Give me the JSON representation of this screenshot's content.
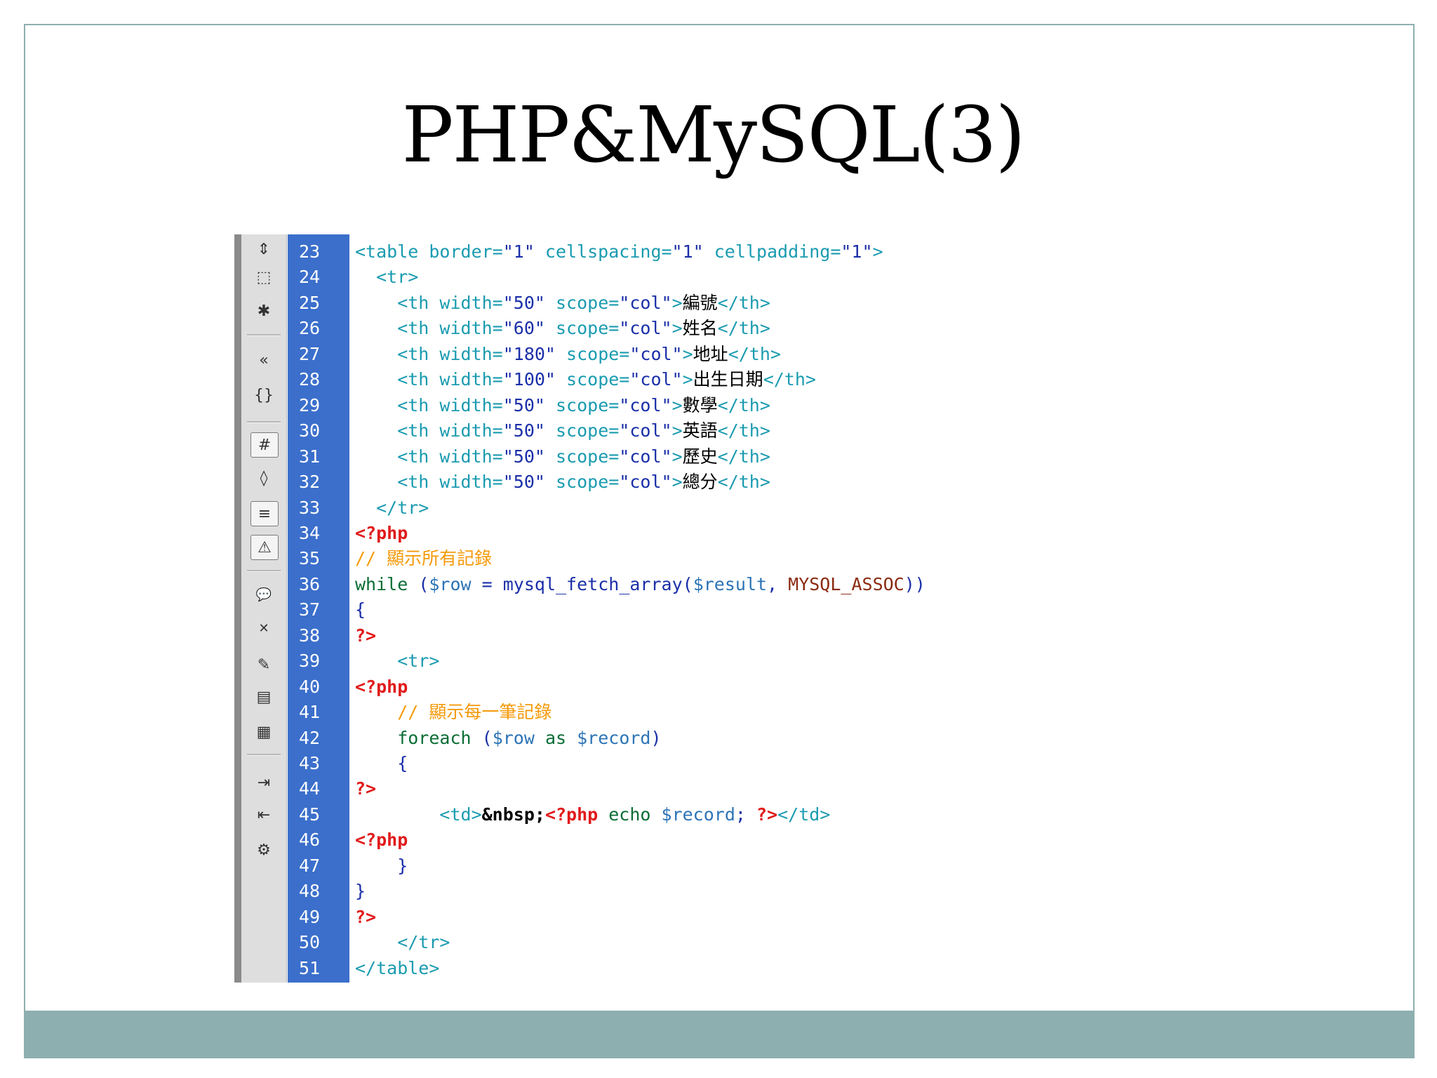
{
  "slide": {
    "title": "PHP&MySQL(3)"
  },
  "colors": {
    "frame": "#8eafb0",
    "gutter": "#3b6fcb",
    "tag": "#1a9bb0",
    "attr_value": "#1a2fa8",
    "php_delim": "#e11a1a",
    "comment": "#f49a0a",
    "keyword": "#0a6d34",
    "variable": "#2d74b6"
  },
  "toolbar": {
    "icons": [
      "collapse-full-tag-icon",
      "collapse-selection-icon",
      "expand-all-icon",
      "select-parent-tag-icon",
      "balance-braces-icon",
      "line-numbers-icon",
      "highlight-invalid-code-icon",
      "word-wrap-icon",
      "syntax-error-alerts-icon",
      "apply-comment-icon",
      "remove-comment-icon",
      "wrap-tag-icon",
      "recent-snippets-icon",
      "move-css-icon",
      "indent-code-icon",
      "outdent-code-icon",
      "format-source-code-icon"
    ]
  },
  "code": {
    "lines": [
      {
        "n": "23",
        "tokens": [
          {
            "c": "tag",
            "t": "<table border="
          },
          {
            "c": "val",
            "t": "\"1\""
          },
          {
            "c": "tag",
            "t": " cellspacing="
          },
          {
            "c": "val",
            "t": "\"1\""
          },
          {
            "c": "tag",
            "t": " cellpadding="
          },
          {
            "c": "val",
            "t": "\"1\""
          },
          {
            "c": "tag",
            "t": ">"
          }
        ]
      },
      {
        "n": "24",
        "tokens": [
          {
            "c": "tag",
            "t": "  <tr>"
          }
        ]
      },
      {
        "n": "25",
        "tokens": [
          {
            "c": "tag",
            "t": "    <th width="
          },
          {
            "c": "val",
            "t": "\"50\""
          },
          {
            "c": "tag",
            "t": " scope="
          },
          {
            "c": "val",
            "t": "\"col\""
          },
          {
            "c": "tag",
            "t": ">"
          },
          {
            "c": "txt",
            "t": "編號"
          },
          {
            "c": "tag",
            "t": "</th>"
          }
        ]
      },
      {
        "n": "26",
        "tokens": [
          {
            "c": "tag",
            "t": "    <th width="
          },
          {
            "c": "val",
            "t": "\"60\""
          },
          {
            "c": "tag",
            "t": " scope="
          },
          {
            "c": "val",
            "t": "\"col\""
          },
          {
            "c": "tag",
            "t": ">"
          },
          {
            "c": "txt",
            "t": "姓名"
          },
          {
            "c": "tag",
            "t": "</th>"
          }
        ]
      },
      {
        "n": "27",
        "tokens": [
          {
            "c": "tag",
            "t": "    <th width="
          },
          {
            "c": "val",
            "t": "\"180\""
          },
          {
            "c": "tag",
            "t": " scope="
          },
          {
            "c": "val",
            "t": "\"col\""
          },
          {
            "c": "tag",
            "t": ">"
          },
          {
            "c": "txt",
            "t": "地址"
          },
          {
            "c": "tag",
            "t": "</th>"
          }
        ]
      },
      {
        "n": "28",
        "tokens": [
          {
            "c": "tag",
            "t": "    <th width="
          },
          {
            "c": "val",
            "t": "\"100\""
          },
          {
            "c": "tag",
            "t": " scope="
          },
          {
            "c": "val",
            "t": "\"col\""
          },
          {
            "c": "tag",
            "t": ">"
          },
          {
            "c": "txt",
            "t": "出生日期"
          },
          {
            "c": "tag",
            "t": "</th>"
          }
        ]
      },
      {
        "n": "29",
        "tokens": [
          {
            "c": "tag",
            "t": "    <th width="
          },
          {
            "c": "val",
            "t": "\"50\""
          },
          {
            "c": "tag",
            "t": " scope="
          },
          {
            "c": "val",
            "t": "\"col\""
          },
          {
            "c": "tag",
            "t": ">"
          },
          {
            "c": "txt",
            "t": "數學"
          },
          {
            "c": "tag",
            "t": "</th>"
          }
        ]
      },
      {
        "n": "30",
        "tokens": [
          {
            "c": "tag",
            "t": "    <th width="
          },
          {
            "c": "val",
            "t": "\"50\""
          },
          {
            "c": "tag",
            "t": " scope="
          },
          {
            "c": "val",
            "t": "\"col\""
          },
          {
            "c": "tag",
            "t": ">"
          },
          {
            "c": "txt",
            "t": "英語"
          },
          {
            "c": "tag",
            "t": "</th>"
          }
        ]
      },
      {
        "n": "31",
        "tokens": [
          {
            "c": "tag",
            "t": "    <th width="
          },
          {
            "c": "val",
            "t": "\"50\""
          },
          {
            "c": "tag",
            "t": " scope="
          },
          {
            "c": "val",
            "t": "\"col\""
          },
          {
            "c": "tag",
            "t": ">"
          },
          {
            "c": "txt",
            "t": "歷史"
          },
          {
            "c": "tag",
            "t": "</th>"
          }
        ]
      },
      {
        "n": "32",
        "tokens": [
          {
            "c": "tag",
            "t": "    <th width="
          },
          {
            "c": "val",
            "t": "\"50\""
          },
          {
            "c": "tag",
            "t": " scope="
          },
          {
            "c": "val",
            "t": "\"col\""
          },
          {
            "c": "tag",
            "t": ">"
          },
          {
            "c": "txt",
            "t": "總分"
          },
          {
            "c": "tag",
            "t": "</th>"
          }
        ]
      },
      {
        "n": "33",
        "tokens": [
          {
            "c": "tag",
            "t": "  </tr>"
          }
        ]
      },
      {
        "n": "34",
        "tokens": [
          {
            "c": "php",
            "t": "<?php"
          }
        ]
      },
      {
        "n": "35",
        "tokens": [
          {
            "c": "cmt",
            "t": "// 顯示所有記錄"
          }
        ]
      },
      {
        "n": "36",
        "tokens": [
          {
            "c": "kw",
            "t": "while"
          },
          {
            "c": "punc",
            "t": " ("
          },
          {
            "c": "var",
            "t": "$row"
          },
          {
            "c": "punc",
            "t": " = "
          },
          {
            "c": "fn",
            "t": "mysql_fetch_array"
          },
          {
            "c": "punc",
            "t": "("
          },
          {
            "c": "var",
            "t": "$result"
          },
          {
            "c": "punc",
            "t": ", "
          },
          {
            "c": "const",
            "t": "MYSQL_ASSOC"
          },
          {
            "c": "punc",
            "t": "))"
          }
        ]
      },
      {
        "n": "37",
        "tokens": [
          {
            "c": "punc",
            "t": "{"
          }
        ]
      },
      {
        "n": "38",
        "tokens": [
          {
            "c": "php",
            "t": "?>"
          }
        ]
      },
      {
        "n": "39",
        "tokens": [
          {
            "c": "tag",
            "t": "    <tr>"
          }
        ]
      },
      {
        "n": "40",
        "tokens": [
          {
            "c": "php",
            "t": "<?php"
          }
        ]
      },
      {
        "n": "41",
        "tokens": [
          {
            "c": "cmt",
            "t": "    // 顯示每一筆記錄"
          }
        ]
      },
      {
        "n": "42",
        "tokens": [
          {
            "c": "kw",
            "t": "    foreach"
          },
          {
            "c": "punc",
            "t": " ("
          },
          {
            "c": "var",
            "t": "$row"
          },
          {
            "c": "kw",
            "t": " as "
          },
          {
            "c": "var",
            "t": "$record"
          },
          {
            "c": "punc",
            "t": ")"
          }
        ]
      },
      {
        "n": "43",
        "tokens": [
          {
            "c": "punc",
            "t": "    {"
          }
        ]
      },
      {
        "n": "44",
        "tokens": [
          {
            "c": "php",
            "t": "?>"
          }
        ]
      },
      {
        "n": "45",
        "tokens": [
          {
            "c": "tag",
            "t": "        <td>"
          },
          {
            "c": "ent",
            "t": "&nbsp;"
          },
          {
            "c": "php",
            "t": "<?php"
          },
          {
            "c": "kw",
            "t": " echo "
          },
          {
            "c": "var",
            "t": "$record"
          },
          {
            "c": "punc",
            "t": "; "
          },
          {
            "c": "php",
            "t": "?>"
          },
          {
            "c": "tag",
            "t": "</td>"
          }
        ]
      },
      {
        "n": "46",
        "tokens": [
          {
            "c": "php",
            "t": "<?php"
          }
        ]
      },
      {
        "n": "47",
        "tokens": [
          {
            "c": "punc",
            "t": "    }"
          }
        ]
      },
      {
        "n": "48",
        "tokens": [
          {
            "c": "punc",
            "t": "}"
          }
        ]
      },
      {
        "n": "49",
        "tokens": [
          {
            "c": "php",
            "t": "?>"
          }
        ]
      },
      {
        "n": "50",
        "tokens": [
          {
            "c": "tag",
            "t": "    </tr>"
          }
        ]
      },
      {
        "n": "51",
        "tokens": [
          {
            "c": "tag",
            "t": "</table>"
          }
        ]
      }
    ]
  }
}
